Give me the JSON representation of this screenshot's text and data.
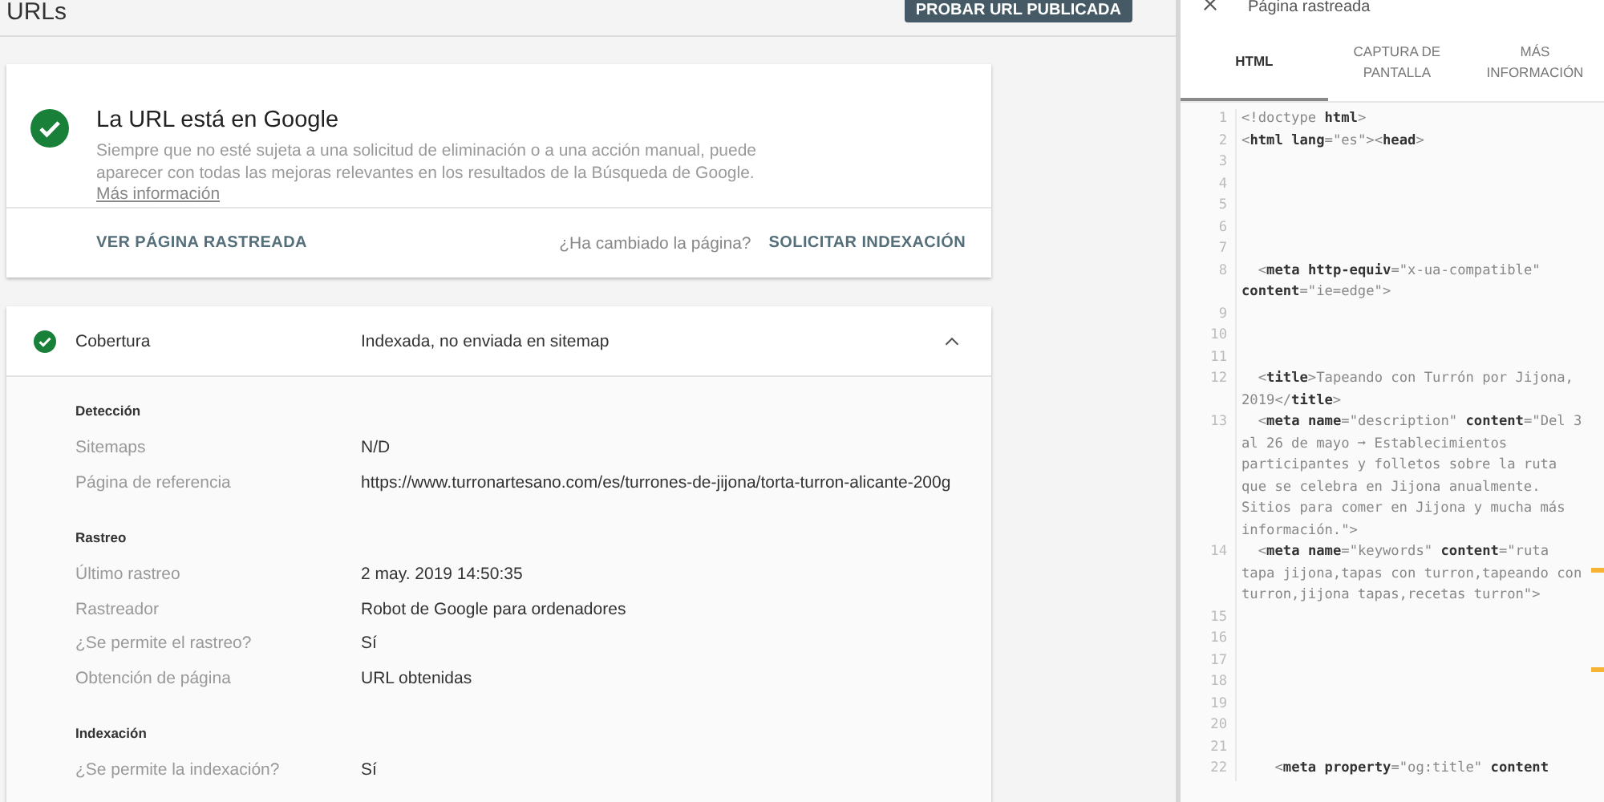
{
  "header": {
    "title": "URLs",
    "button": "PROBAR URL PUBLICADA"
  },
  "status_card": {
    "title": "La URL está en Google",
    "description": "Siempre que no esté sujeta a una solicitud de eliminación o a una acción manual, puede aparecer con todas las mejoras relevantes en los resultados de la Búsqueda de Google.",
    "link": "Más información",
    "action_left": "VER PÁGINA RASTREADA",
    "question": "¿Ha cambiado la página?",
    "action_right": "SOLICITAR INDEXACIÓN"
  },
  "coverage": {
    "label": "Cobertura",
    "value": "Indexada, no enviada en sitemap",
    "expanded": true,
    "sections": [
      {
        "heading": "Detección",
        "rows": [
          {
            "label": "Sitemaps",
            "value": "N/D"
          },
          {
            "label": "Página de referencia",
            "value": "https://www.turronartesano.com/es/turrones-de-jijona/torta-turron-alicante-200g"
          }
        ]
      },
      {
        "heading": "Rastreo",
        "rows": [
          {
            "label": "Último rastreo",
            "value": "2 may. 2019 14:50:35"
          },
          {
            "label": "Rastreador",
            "value": "Robot de Google para ordenadores"
          },
          {
            "label": "¿Se permite el rastreo?",
            "value": "Sí"
          },
          {
            "label": "Obtención de página",
            "value": "URL obtenidas"
          }
        ]
      },
      {
        "heading": "Indexación",
        "rows": [
          {
            "label": "¿Se permite la indexación?",
            "value": "Sí"
          }
        ]
      }
    ]
  },
  "crawled_panel": {
    "title": "Página rastreada",
    "tabs": [
      {
        "label": "HTML",
        "selected": true
      },
      {
        "label": "CAPTURA DE PANTALLA",
        "selected": false
      },
      {
        "label": "MÁS INFORMACIÓN",
        "selected": false
      }
    ],
    "code_lines": [
      {
        "number": "1",
        "text": "<!doctype **html**>"
      },
      {
        "number": "2",
        "text": "<**html** **lang**=\"es\"><**head**>"
      },
      {
        "number": "3"
      },
      {
        "number": "4"
      },
      {
        "number": "5"
      },
      {
        "number": "6"
      },
      {
        "number": "7"
      },
      {
        "number": "8",
        "text": "  <**meta** **http-equiv**=\"x-ua-compatible\" **content**=\"ie=edge\">"
      },
      {
        "number": "9"
      },
      {
        "number": "10"
      },
      {
        "number": "11"
      },
      {
        "number": "12",
        "text": "  <**title**>Tapeando con Turrón por Jijona, 2019</**title**>"
      },
      {
        "number": "13",
        "text": "  <**meta** **name**=\"description\" **content**=\"Del 3 al 26 de mayo ➞ Establecimientos participantes y folletos sobre la ruta que se celebra en Jijona anualmente. Sitios para comer en Jijona y mucha más información.\">"
      },
      {
        "number": "14",
        "text": "  <**meta** **name**=\"keywords\" **content**=\"ruta tapa jijona,tapas con turron,tapeando con turron,jijona tapas,recetas turron\">"
      },
      {
        "number": "15"
      },
      {
        "number": "16"
      },
      {
        "number": "17"
      },
      {
        "number": "18"
      },
      {
        "number": "19"
      },
      {
        "number": "20"
      },
      {
        "number": "21"
      },
      {
        "number": "22",
        "text": "    <**meta** **property**=\"og:title\" **content**"
      }
    ]
  }
}
